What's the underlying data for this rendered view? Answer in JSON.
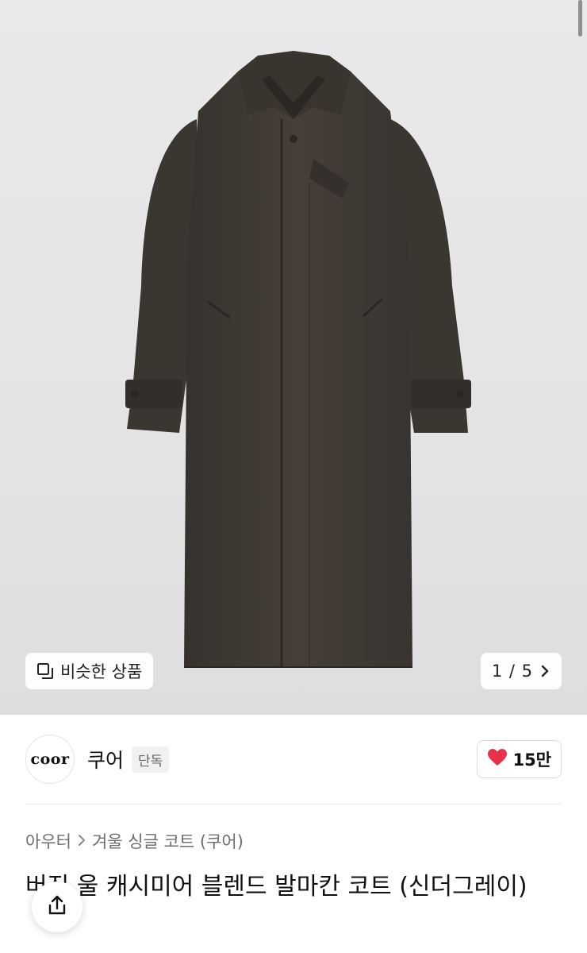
{
  "gallery": {
    "similar_label": "비슷한 상품",
    "counter": "1 / 5"
  },
  "brand": {
    "logo_text": "coor",
    "name": "쿠어",
    "badge": "단독",
    "likes": "15만"
  },
  "breadcrumb": {
    "category": "아우터",
    "subcategory": "겨울 싱글 코트 (쿠어)"
  },
  "product": {
    "title": "버진 울 캐시미어 블렌드 발마칸 코트 (신더그레이)"
  },
  "colors": {
    "heart": "#e8324a",
    "coat": "#403a34"
  },
  "icons": {
    "similar": "similar-products-icon",
    "counter_arrow": "chevron-right-icon",
    "heart": "heart-icon",
    "breadcrumb_sep": "chevron-right-icon",
    "share": "share-icon"
  }
}
